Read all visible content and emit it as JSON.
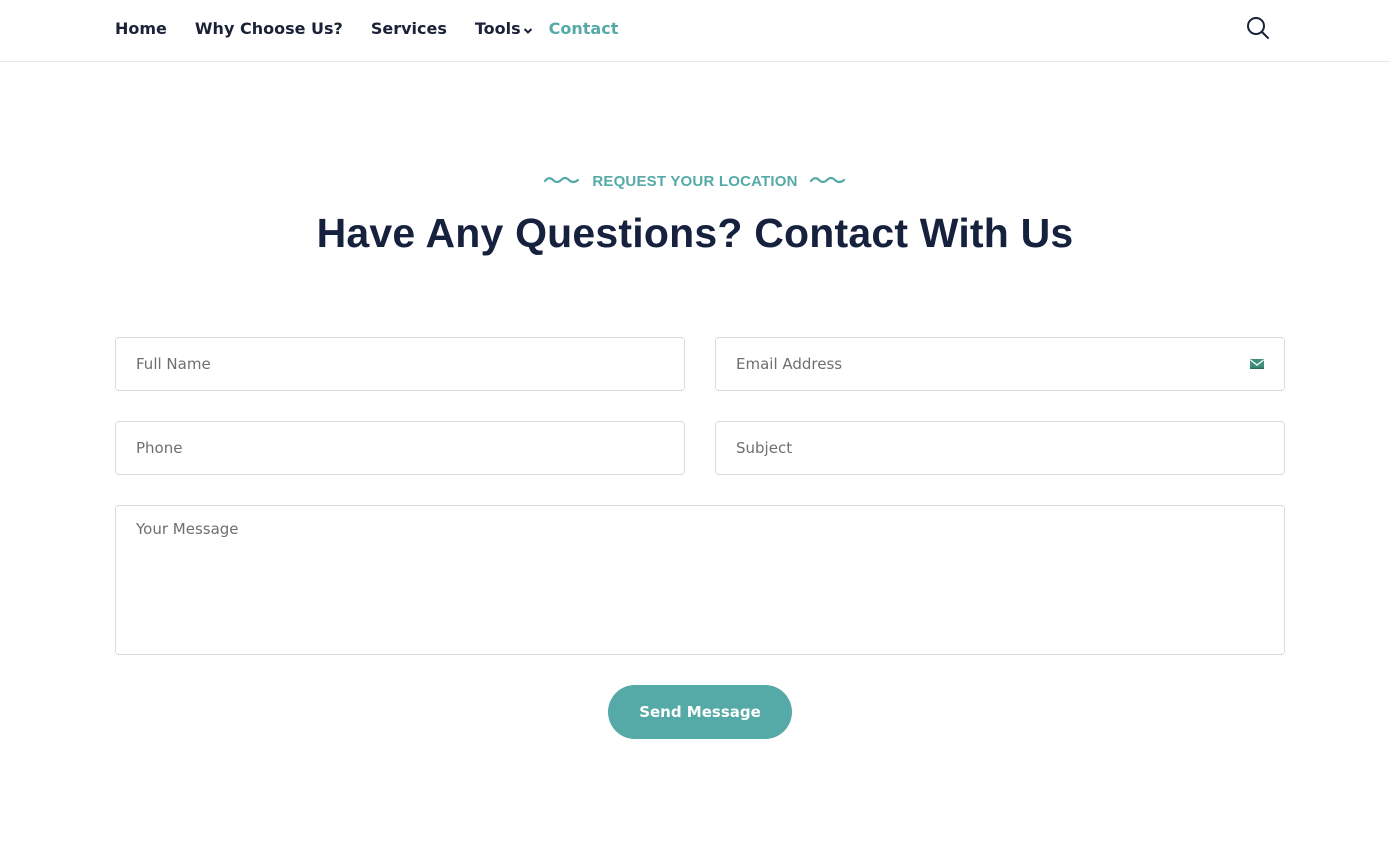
{
  "nav": {
    "items": [
      {
        "label": "Home",
        "active": false
      },
      {
        "label": "Why Choose Us?",
        "active": false
      },
      {
        "label": "Services",
        "active": false
      },
      {
        "label": "Tools",
        "active": false,
        "has_dropdown": true
      },
      {
        "label": "Contact",
        "active": true
      }
    ],
    "search_icon": "search-icon"
  },
  "section": {
    "eyebrow": "REQUEST YOUR LOCATION",
    "title": "Have Any Questions? Contact With Us"
  },
  "form": {
    "full_name_placeholder": "Full Name",
    "email_placeholder": "Email Address",
    "phone_placeholder": "Phone",
    "subject_placeholder": "Subject",
    "message_placeholder": "Your Message",
    "submit_label": "Send Message"
  },
  "colors": {
    "accent": "#55aaa7",
    "heading": "#16213e",
    "nav_text": "#1b2238"
  }
}
